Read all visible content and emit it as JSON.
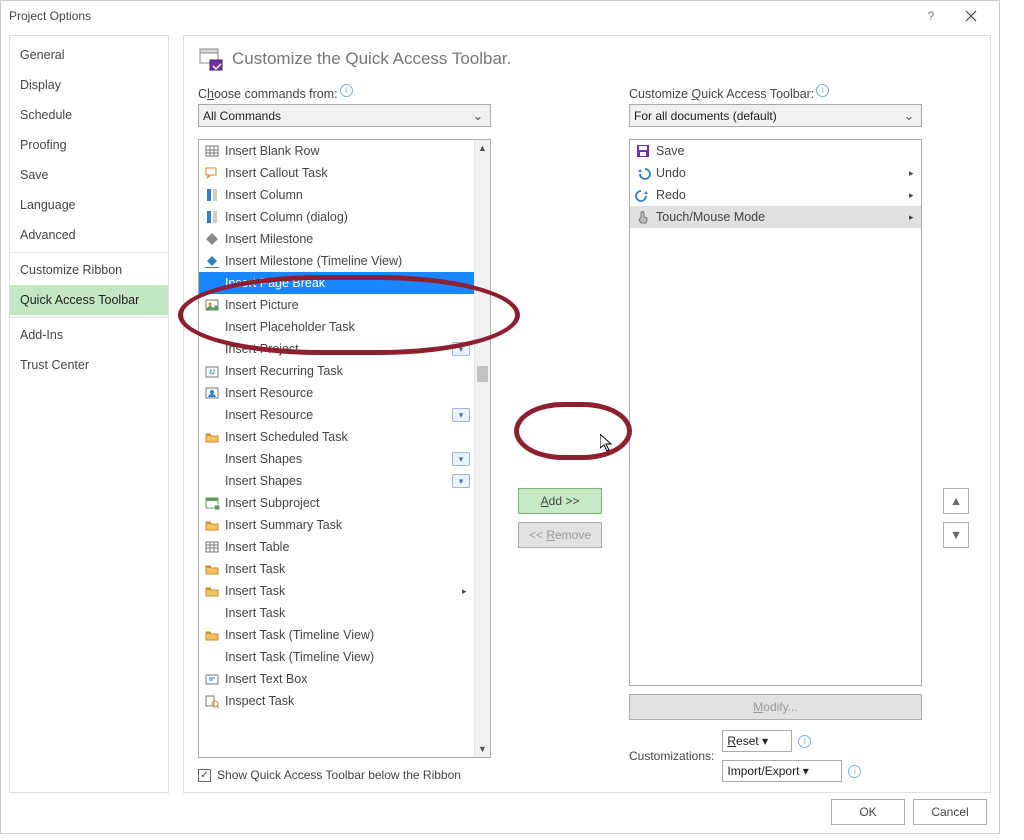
{
  "title": "Project Options",
  "sidebar": {
    "items": [
      {
        "label": "General"
      },
      {
        "label": "Display"
      },
      {
        "label": "Schedule"
      },
      {
        "label": "Proofing"
      },
      {
        "label": "Save"
      },
      {
        "label": "Language"
      },
      {
        "label": "Advanced"
      },
      {
        "label": "Customize Ribbon"
      },
      {
        "label": "Quick Access Toolbar",
        "selected": true
      },
      {
        "label": "Add-Ins"
      },
      {
        "label": "Trust Center"
      }
    ]
  },
  "main": {
    "heading": "Customize the Quick Access Toolbar.",
    "left": {
      "label_pre": "C",
      "label_u": "h",
      "label_post": "oose commands from:",
      "combo": "All Commands",
      "items": [
        {
          "label": "Insert Blank Row",
          "icon": "grid"
        },
        {
          "label": "Insert Callout Task",
          "icon": "callout"
        },
        {
          "label": "Insert Column",
          "icon": "col"
        },
        {
          "label": "Insert Column (dialog)",
          "icon": "col"
        },
        {
          "label": "Insert Milestone",
          "icon": "milestone"
        },
        {
          "label": "Insert Milestone (Timeline View)",
          "icon": "milestone-tl"
        },
        {
          "label": "Insert Page Break",
          "icon": "",
          "selected": true
        },
        {
          "label": "Insert Picture",
          "icon": "picture"
        },
        {
          "label": "Insert Placeholder Task",
          "icon": ""
        },
        {
          "label": "Insert Project",
          "icon": "",
          "split": true
        },
        {
          "label": "Insert Recurring Task",
          "icon": "recurring"
        },
        {
          "label": "Insert Resource",
          "icon": "resource"
        },
        {
          "label": "Insert Resource",
          "icon": "",
          "split": true
        },
        {
          "label": "Insert Scheduled Task",
          "icon": "folder"
        },
        {
          "label": "Insert Shapes",
          "icon": "",
          "split": true
        },
        {
          "label": "Insert Shapes",
          "icon": "",
          "split": true
        },
        {
          "label": "Insert Subproject",
          "icon": "subproject"
        },
        {
          "label": "Insert Summary Task",
          "icon": "folder"
        },
        {
          "label": "Insert Table",
          "icon": "table"
        },
        {
          "label": "Insert Task",
          "icon": "folder"
        },
        {
          "label": "Insert Task",
          "icon": "folder",
          "flyout": true
        },
        {
          "label": "Insert Task",
          "icon": ""
        },
        {
          "label": "Insert Task (Timeline View)",
          "icon": "folder"
        },
        {
          "label": "Insert Task (Timeline View)",
          "icon": ""
        },
        {
          "label": "Insert Text Box",
          "icon": "textbox"
        },
        {
          "label": "Inspect Task",
          "icon": "inspect"
        }
      ]
    },
    "right": {
      "label_pre": "Customize ",
      "label_u": "Q",
      "label_post": "uick Access Toolbar:",
      "combo": "For all documents (default)",
      "items": [
        {
          "label": "Save",
          "icon": "save"
        },
        {
          "label": "Undo",
          "icon": "undo",
          "flyout": true
        },
        {
          "label": "Redo",
          "icon": "redo",
          "flyout": true
        },
        {
          "label": "Touch/Mouse Mode",
          "icon": "touch",
          "flyout": true,
          "selected": true
        }
      ],
      "modify": "Modify...",
      "customizations_label": "Customizations:",
      "reset": "Reset",
      "import_export": "Import/Export"
    },
    "add_label": "Add >>",
    "remove_pre": "<< ",
    "remove_u": "R",
    "remove_post": "emove",
    "show_qat_pre": "S",
    "show_qat_u": "h",
    "show_qat_post": "ow Quick Access Toolbar below the Ribbon"
  },
  "footer": {
    "ok": "OK",
    "cancel": "Cancel"
  }
}
